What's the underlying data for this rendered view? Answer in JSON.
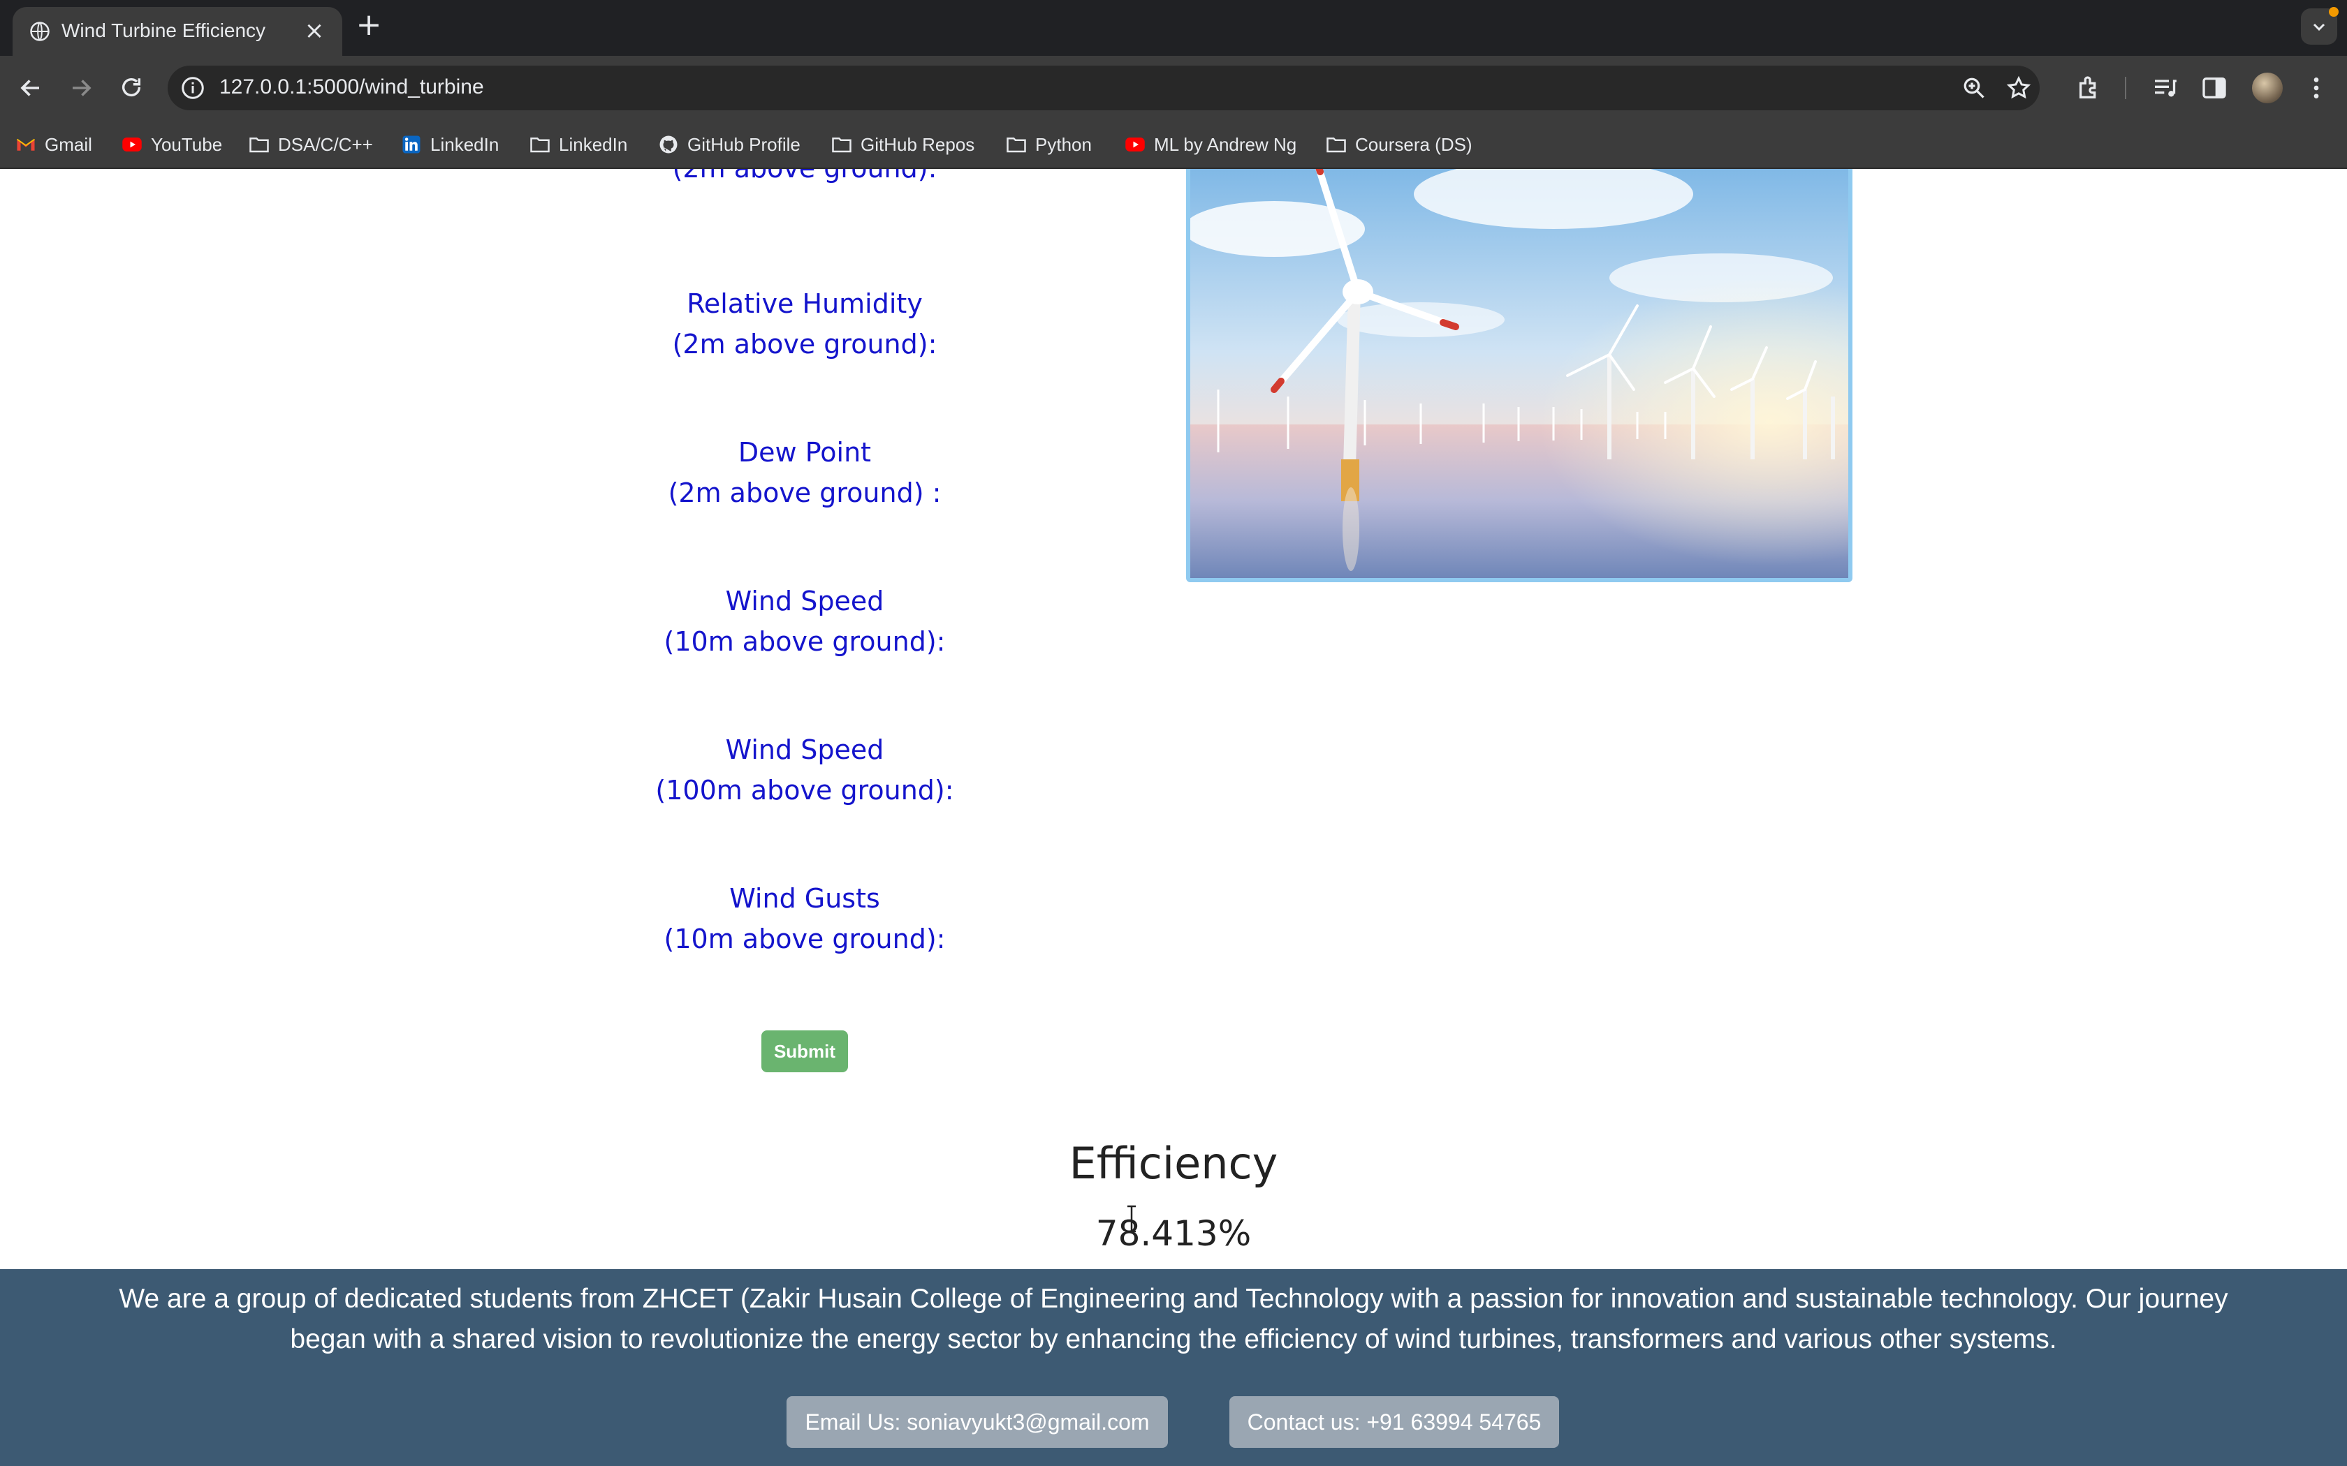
{
  "browser": {
    "tab_title": "Wind Turbine Efficiency",
    "url": "127.0.0.1:5000/wind_turbine",
    "bookmarks": [
      "Gmail",
      "YouTube",
      "DSA/C/C++",
      "LinkedIn",
      "LinkedIn",
      "GitHub Profile",
      "GitHub Repos",
      "Python",
      "ML by Andrew Ng",
      "Coursera (DS)"
    ]
  },
  "form": {
    "fields": [
      {
        "line1": "",
        "line2": "(2m above ground):"
      },
      {
        "line1": "Relative Humidity",
        "line2": "(2m above ground):"
      },
      {
        "line1": "Dew Point",
        "line2": "(2m above ground) :"
      },
      {
        "line1": "Wind Speed",
        "line2": "(10m above ground):"
      },
      {
        "line1": "Wind Speed",
        "line2": "(100m above ground):"
      },
      {
        "line1": "Wind Gusts",
        "line2": "(10m above ground):"
      }
    ],
    "submit_label": "Submit"
  },
  "result": {
    "title": "Efficiency",
    "value": "78.413%"
  },
  "footer": {
    "about": "We are a group of dedicated students from ZHCET (Zakir Husain College of Engineering and Technology with a passion for innovation and sustainable technology. Our journey began with a shared vision to revolutionize the energy sector by enhancing the efficiency of wind turbines, transformers and various other systems.",
    "email_label": "Email Us: soniavyukt3@gmail.com",
    "contact_label": "Contact us: +91 63994 54765"
  }
}
